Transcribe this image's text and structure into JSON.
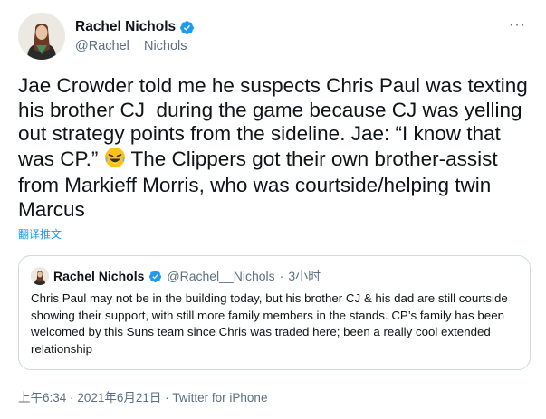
{
  "author": {
    "name": "Rachel Nichols",
    "handle": "@Rachel__Nichols"
  },
  "menu": {
    "more_label": "···"
  },
  "tweet": {
    "text": "Jae Crowder told me he suspects Chris Paul was texting his brother CJ  during the game because CJ was yelling out strategy points from the sideline. Jae: “I know that was CP.” ",
    "emoji": "laughing-crying-emoji",
    "text_after_emoji": " The Clippers got their own brother-assist from Markieff Morris, who was courtside/helping twin Marcus",
    "translate_label": "翻译推文"
  },
  "quoted": {
    "name": "Rachel Nichols",
    "handle": "@Rachel__Nichols",
    "separator": "·",
    "time": "3小时",
    "text": "Chris Paul may not be in the building today, but his brother CJ & his dad are still courtside showing their support, with still more family members in the stands. CP’s family has been welcomed by this Suns team since Chris was traded here; been a really cool extended relationship"
  },
  "meta": {
    "time": "上午6:34",
    "separator": "·",
    "date": "2021年6月21日",
    "source": "Twitter for iPhone"
  },
  "colors": {
    "verified": "#1d9bf0",
    "secondary_text": "#5b7083",
    "link": "#1d9bf0",
    "border": "#cfd9de"
  }
}
